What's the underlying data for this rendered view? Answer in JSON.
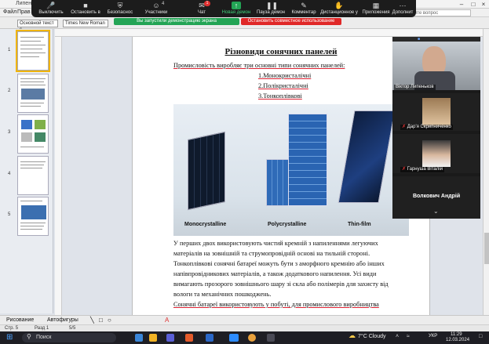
{
  "word": {
    "title_short": "Липеньк",
    "menu": [
      "Файл",
      "Прав"
    ],
    "help_placeholder": "Введите вопрос",
    "style_box": "Основной текст с",
    "font_box": "Times New Roman",
    "page_numbers": [
      "1",
      "2",
      "3",
      "4",
      "5"
    ]
  },
  "zoom": {
    "buttons": [
      {
        "label": "Выключить",
        "icon": "mic-icon"
      },
      {
        "label": "Остановить в",
        "icon": "video-icon"
      },
      {
        "label": "Безопаснос",
        "icon": "shield-icon"
      },
      {
        "label": "Участники",
        "icon": "participants-icon",
        "badge": "4"
      },
      {
        "label": "Чат",
        "icon": "chat-icon",
        "badge": "1"
      },
      {
        "label": "Новая демон",
        "icon": "share-screen-icon"
      },
      {
        "label": "Пауза демон",
        "icon": "pause-icon"
      },
      {
        "label": "Комментар",
        "icon": "annotate-icon"
      },
      {
        "label": "Дистанционное у",
        "icon": "remote-control-icon"
      },
      {
        "label": "Приложения",
        "icon": "apps-icon"
      },
      {
        "label": "Дополнит",
        "icon": "more-icon"
      }
    ],
    "share_status": "Вы запустили демонстрацию экрана",
    "stop_share": "Остановить совместное использование",
    "participants": [
      {
        "name": "Віктор Липеньков"
      },
      {
        "name": "Дар'я Скрипниченко"
      },
      {
        "name": "Гарнуша Віталій"
      },
      {
        "name": "Волкович Андрій"
      }
    ]
  },
  "document": {
    "title": "Різновиди сонячних панелей",
    "intro": "Промисловість виробляє три основні типи сонячних панелей:",
    "list": [
      "1.Монокристалічні",
      "2.Полікристалічні",
      "3.Тонкоплівкові"
    ],
    "panel_captions": [
      "Monocrystalline",
      "Polycrystalline",
      "Thin-film"
    ],
    "paragraph_lines": [
      "У перших двох використовують чистий кремній з напиленнями легуючих",
      "матеріалів на зовнішній та струмопровідній основі на тильній стороні.",
      "Тонкоплівкові сонячні батареї можуть бути з аморфного кремнію або інших",
      "напівпровідникових матеріалів, а також додаткового напилення. Усі види",
      "вимагають прозорого зовнішнього шару зі скла або полімерів для захисту від",
      "вологи та механічних пошкоджень.",
      "Сонячні батареї використовують у побуті, для промислового виробництва"
    ]
  },
  "drawbar": {
    "draw_label": "Рисование",
    "autoshapes_label": "Автофигуры"
  },
  "status": {
    "page": "Стр. 5",
    "section": "Разд 1",
    "pages": "5/5"
  },
  "taskbar": {
    "search_label": "Поиск",
    "weather": "7°C  Cloudy",
    "lang": "УКР",
    "time": "11:29",
    "date": "12.03.2024"
  }
}
